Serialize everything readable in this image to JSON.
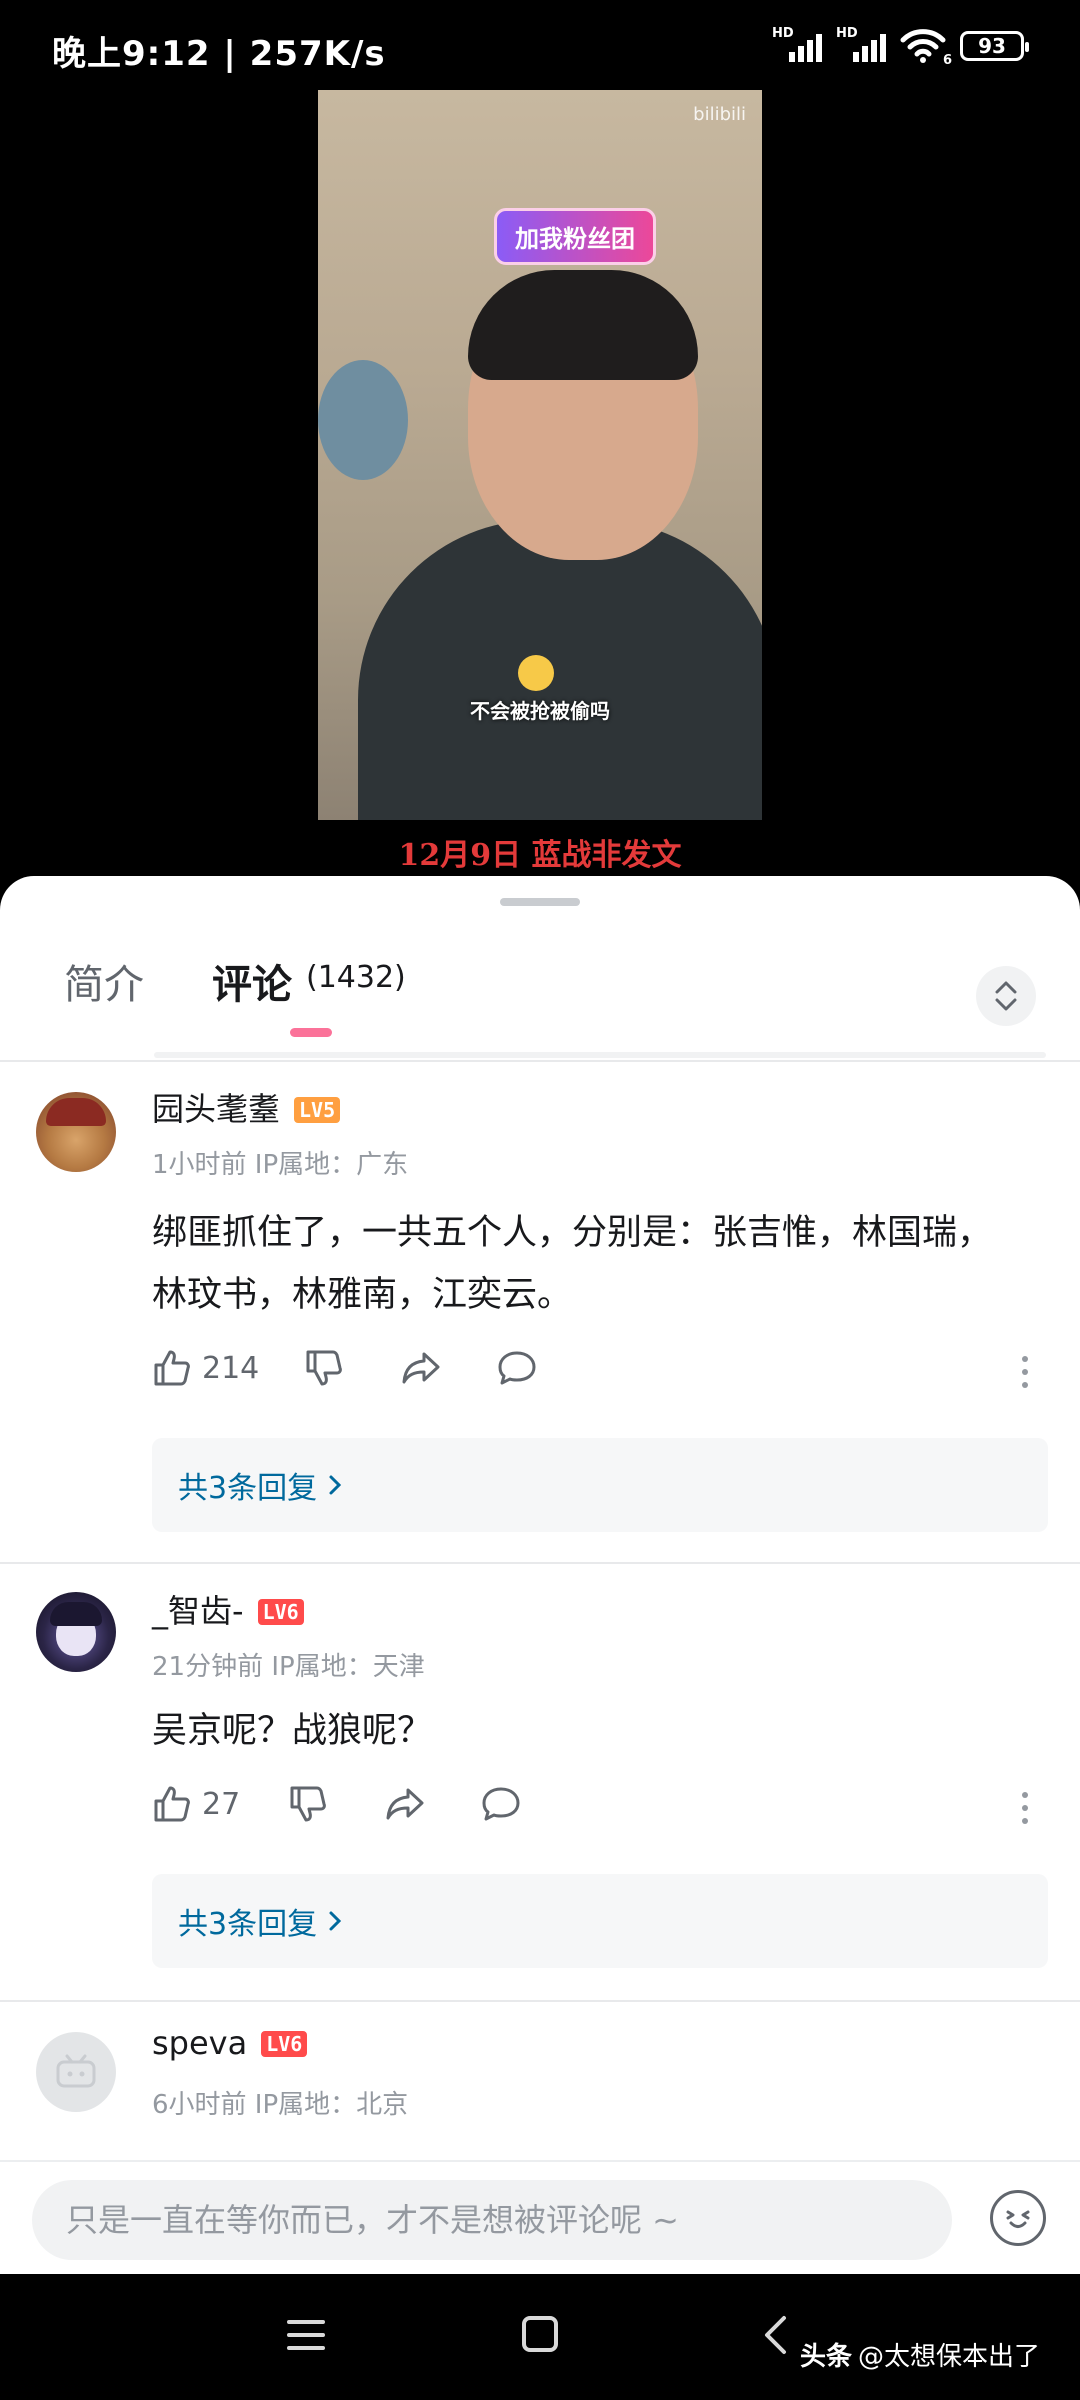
{
  "status_bar": {
    "time": "晚上9:12 | 257K/s",
    "signal_label": "HD",
    "wifi_sub": "6",
    "battery": "93"
  },
  "video": {
    "watermark": "bilibili",
    "fans_sign": "加我粉丝团",
    "subtitle": "不会被抢被偷吗",
    "caption": "12月9日 蓝战非发文"
  },
  "tabs": {
    "intro": "简介",
    "comments": "评论",
    "comment_count": "(1432)"
  },
  "comments": [
    {
      "username": "园头耄耋",
      "level": "LV5",
      "meta": "1小时前 IP属地：广东",
      "lines": [
        "绑匪抓住了，一共五个人，分别是：张吉惟，林国瑞，",
        "林玟书，林雅南，江奕云。"
      ],
      "likes": "214",
      "replies": "共3条回复"
    },
    {
      "username": "_智齿-",
      "level": "LV6",
      "meta": "21分钟前 IP属地：天津",
      "lines": [
        "吴京呢？战狼呢？"
      ],
      "likes": "27",
      "replies": "共3条回复"
    },
    {
      "username": "speva",
      "level": "LV6",
      "meta": "6小时前 IP属地：北京"
    }
  ],
  "input": {
    "placeholder": "只是一直在等你而已，才不是想被评论呢 ~"
  },
  "credit": {
    "brand": "头条",
    "author": "@太想保本出了"
  },
  "colors": {
    "accent_pink": "#fb7299",
    "link_blue": "#00699d",
    "caption_red": "#e33a3a"
  }
}
